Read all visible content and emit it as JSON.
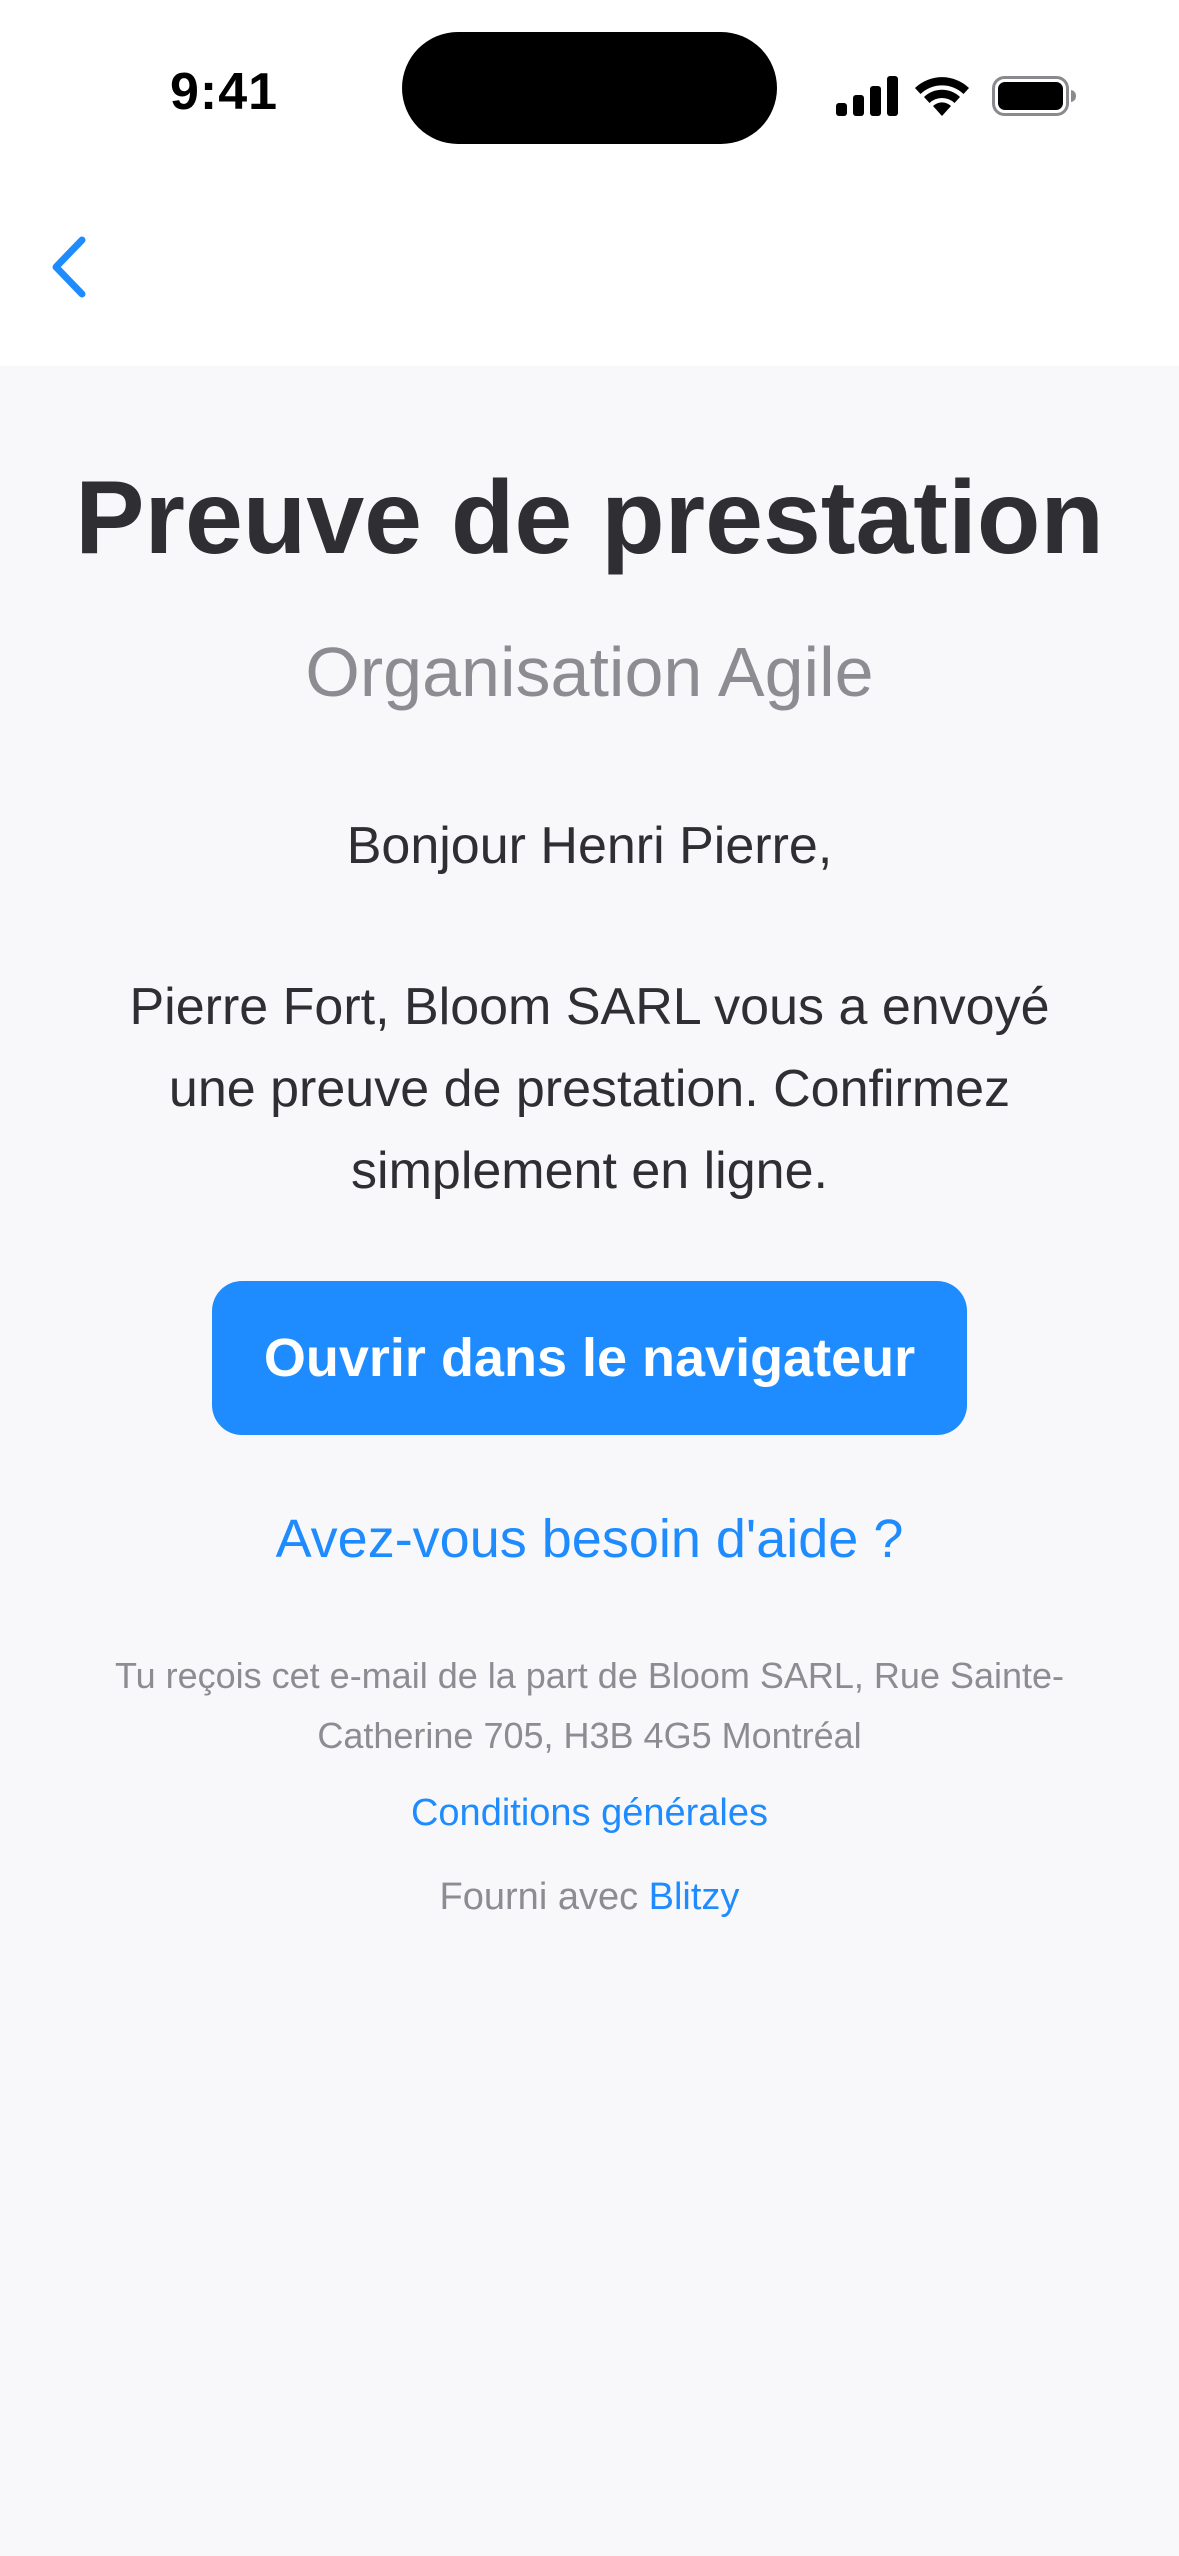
{
  "status_bar": {
    "time": "9:41",
    "icons": [
      "signal-icon",
      "wifi-icon",
      "battery-icon"
    ]
  },
  "nav": {
    "back_icon": "chevron-left-icon"
  },
  "email": {
    "title": "Preuve de prestation",
    "subtitle": "Organisation Agile",
    "greeting": "Bonjour Henri Pierre,",
    "message": "Pierre Fort, Bloom SARL vous a envoyé une preuve de prestation. Confirmez simplement en ligne.",
    "cta_label": "Ouvrir dans le navigateur",
    "help_link": "Avez-vous besoin d'aide ?",
    "footer_note": "Tu reçois cet e-mail de la part de Bloom SARL, Rue Sainte-Catherine 705, H3B 4G5 Montréal",
    "terms_link": "Conditions générales",
    "powered_prefix": "Fourni avec ",
    "powered_brand": "Blitzy"
  },
  "colors": {
    "accent": "#1e8cff",
    "text_dark": "#2f2f33",
    "text_muted": "#8c8c92",
    "background": "#f8f8fa",
    "header_bg": "#ffffff"
  }
}
